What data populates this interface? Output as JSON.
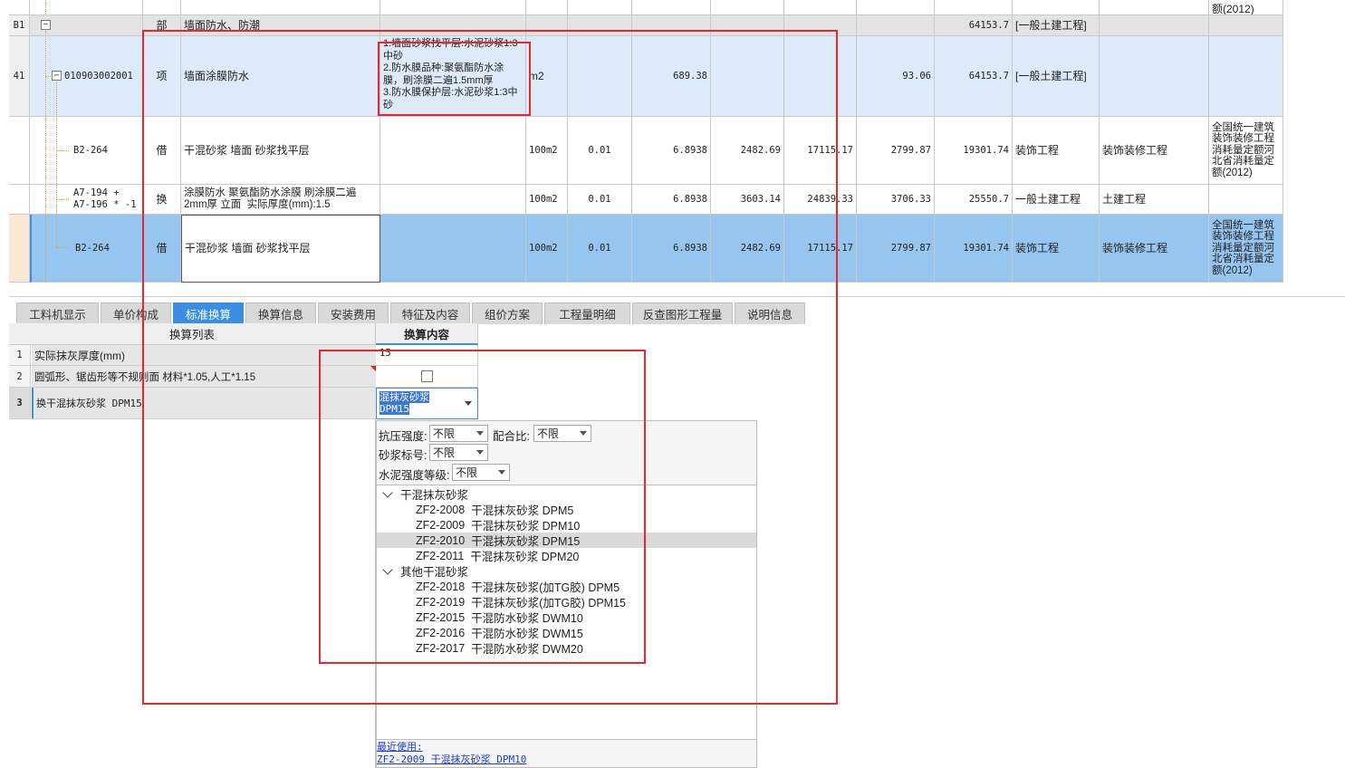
{
  "grid": {
    "top_partial": {
      "last_text": "额(2012)"
    },
    "row_b1": {
      "num": "B1",
      "type": "部",
      "name": "墙面防水、防潮",
      "total": "64153.7",
      "category": "[一般土建工程]"
    },
    "row_41": {
      "num": "41",
      "code": "010903002001",
      "type": "项",
      "name": "墙面涂膜防水",
      "feature": "1.墙面砂浆找平层:水泥砂浆1:3中砂\n2.防水膜品种:聚氨酯防水涂膜，刷涂膜二遍1.5mm厚\n3.防水膜保护层:水泥砂浆1:3中砂",
      "unit": "m2",
      "quantity": "689.38",
      "unit_price": "93.06",
      "total": "64153.7",
      "category": "[一般土建工程]"
    },
    "row_b2_264": {
      "code": "B2-264",
      "type": "借",
      "name": "干混砂浆 墙面 砂浆找平层",
      "unit": "100m2",
      "coef": "0.01",
      "quantity": "6.8938",
      "price": "2482.69",
      "amount": "17115.17",
      "unit_price": "2799.87",
      "total": "19301.74",
      "category": "装饰工程",
      "specialty": "装饰装修工程",
      "quota": "全国统一建筑装饰装修工程消耗量定额河北省消耗量定额(2012)"
    },
    "row_a7": {
      "code": "A7-194 + A7-196 * -1",
      "type": "换",
      "name": "涂膜防水 聚氨酯防水涂膜 刷涂膜二遍2mm厚 立面  实际厚度(mm):1.5",
      "unit": "100m2",
      "coef": "0.01",
      "quantity": "6.8938",
      "price": "3603.14",
      "amount": "24839.33",
      "unit_price": "3706.33",
      "total": "25550.7",
      "category": "一般土建工程",
      "specialty": "土建工程"
    },
    "row_sel": {
      "code": "B2-264",
      "type": "借",
      "name": "干混砂浆 墙面 砂浆找平层",
      "unit": "100m2",
      "coef": "0.01",
      "quantity": "6.8938",
      "price": "2482.69",
      "amount": "17115.17",
      "unit_price": "2799.87",
      "total": "19301.74",
      "category": "装饰工程",
      "specialty": "装饰装修工程",
      "quota": "全国统一建筑装饰装修工程消耗量定额河北省消耗量定额(2012)"
    }
  },
  "tabs": [
    "工料机显示",
    "单价构成",
    "标准换算",
    "换算信息",
    "安装费用",
    "特征及内容",
    "组价方案",
    "工程量明细",
    "反查图形工程量",
    "说明信息"
  ],
  "active_tab": "标准换算",
  "conversion": {
    "list_header": "换算列表",
    "content_header": "换算内容",
    "rows": [
      {
        "num": "1",
        "label": "实际抹灰厚度(mm)",
        "value": "15"
      },
      {
        "num": "2",
        "label": "圆弧形、锯齿形等不规则面 材料*1.05,人工*1.15",
        "value": ""
      },
      {
        "num": "3",
        "label": "换干混抹灰砂浆 DPM15",
        "value": "混抹灰砂浆 DPM15"
      }
    ]
  },
  "dropdown": {
    "compressive_label": "抗压强度:",
    "compressive_value": "不限",
    "mix_label": "配合比:",
    "mix_value": "不限",
    "mortar_label": "砂浆标号:",
    "mortar_value": "不限",
    "cement_label": "水泥强度等级:",
    "cement_value": "不限",
    "groups": [
      {
        "name": "干混抹灰砂浆",
        "items": [
          {
            "code": "ZF2-2008",
            "name": "干混抹灰砂浆 DPM5"
          },
          {
            "code": "ZF2-2009",
            "name": "干混抹灰砂浆 DPM10"
          },
          {
            "code": "ZF2-2010",
            "name": "干混抹灰砂浆 DPM15"
          },
          {
            "code": "ZF2-2011",
            "name": "干混抹灰砂浆 DPM20"
          }
        ]
      },
      {
        "name": "其他干混砂浆",
        "items": [
          {
            "code": "ZF2-2018",
            "name": "干混抹灰砂浆(加TG胶) DPM5"
          },
          {
            "code": "ZF2-2019",
            "name": "干混抹灰砂浆(加TG胶) DPM15"
          },
          {
            "code": "ZF2-2015",
            "name": "干混防水砂浆 DWM10"
          },
          {
            "code": "ZF2-2016",
            "name": "干混防水砂浆 DWM15"
          },
          {
            "code": "ZF2-2017",
            "name": "干混防水砂浆 DWM20"
          }
        ]
      }
    ],
    "selected_code": "ZF2-2010",
    "recent_label": "最近使用:",
    "recent_item": "ZF2-2009 干混抹灰砂浆 DPM10"
  },
  "colors": {
    "active_tab": "#3a8ee6",
    "selected_row": "#96c6f0",
    "highlight_box": "#e8262b"
  }
}
